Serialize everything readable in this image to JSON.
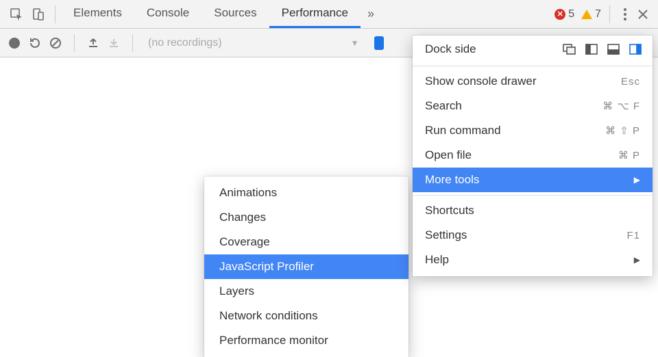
{
  "tabs": {
    "elements": "Elements",
    "console": "Console",
    "sources": "Sources",
    "performance": "Performance"
  },
  "tabs_overflow_glyph": "»",
  "status": {
    "errors": "5",
    "warnings": "7"
  },
  "toolbar2": {
    "no_recordings": "(no recordings)"
  },
  "main_menu": {
    "dock_side": "Dock side",
    "show_console": "Show console drawer",
    "show_console_kb": "Esc",
    "search": "Search",
    "search_kb": "⌘ ⌥ F",
    "run_command": "Run command",
    "run_command_kb": "⌘ ⇧ P",
    "open_file": "Open file",
    "open_file_kb": "⌘ P",
    "more_tools": "More tools",
    "shortcuts": "Shortcuts",
    "settings": "Settings",
    "settings_kb": "F1",
    "help": "Help"
  },
  "sub_menu": {
    "animations": "Animations",
    "changes": "Changes",
    "coverage": "Coverage",
    "js_profiler": "JavaScript Profiler",
    "layers": "Layers",
    "network_conditions": "Network conditions",
    "performance_monitor": "Performance monitor"
  }
}
